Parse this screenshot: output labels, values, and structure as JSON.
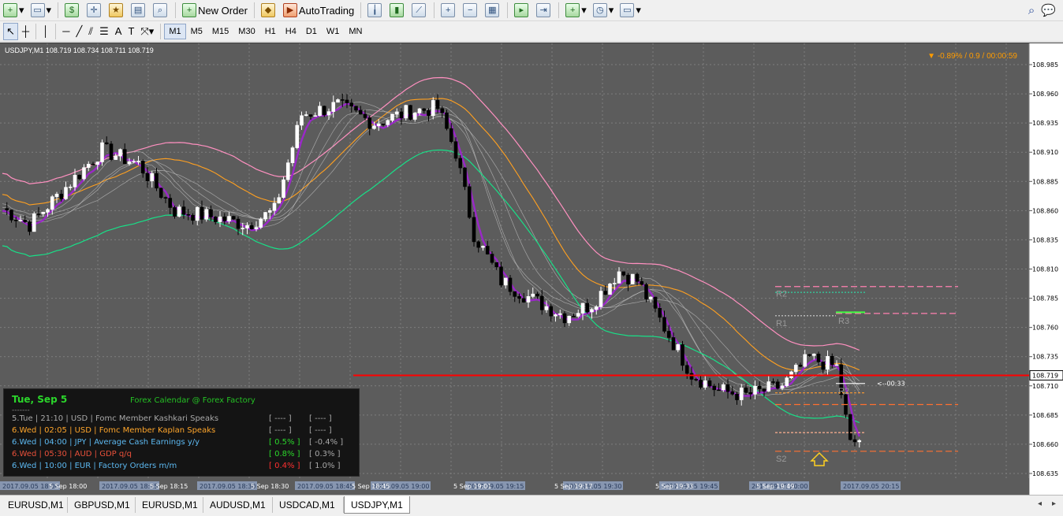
{
  "toolbar": {
    "new_order": "New Order",
    "auto_trading": "AutoTrading",
    "timeframes": [
      "M1",
      "M5",
      "M15",
      "M30",
      "H1",
      "H4",
      "D1",
      "W1",
      "MN"
    ],
    "active_timeframe": "M1"
  },
  "chart": {
    "title": "USDJPY,M1  108.719 108.734 108.711 108.719",
    "top_right": "▼ -0.89% / 0.9 / 00:00:59",
    "countdown": "<--00:33",
    "current_price": "108.719",
    "price_labels": [
      "108.985",
      "108.960",
      "108.935",
      "108.910",
      "108.885",
      "108.860",
      "108.835",
      "108.810",
      "108.785",
      "108.760",
      "108.735",
      "108.710",
      "108.685",
      "108.660",
      "108.635"
    ],
    "pivots": {
      "r2": "R2",
      "r1": "R1",
      "r3": "R3",
      "s2": "S2",
      "r2b": "R2"
    },
    "time_labels": [
      "5 Sep 18:00",
      "5 Sep 18:15",
      "5 Sep 18:30",
      "5 Sep 18:45",
      "5 Sep 19:01",
      "5 Sep 19:17",
      "5 Sep 19:33",
      "5 Sep 19:49",
      "5 Sep 20:05"
    ],
    "time_boxes": [
      "2017.09.05 18:00",
      "2017.09.05 18:15",
      "2017.09.05 18:30",
      "2017.09.05 18:45",
      "2017.09.05 19:00",
      "2017.09.05 19:15",
      "2017.09.05 19:30",
      "2017.09.05 19:45",
      "2017.09.05 20:00",
      "2017.09.05 20:15"
    ],
    "colors": {
      "background": "#5c5c5c",
      "bull": "#ffffff",
      "bear": "#000000",
      "purple": "#9a28c8",
      "green": "#18e088",
      "orange": "#ffa020",
      "pink": "#ff90c0",
      "red_line": "#ff0000"
    }
  },
  "calendar": {
    "day": "Tue, Sep 5",
    "source": "Forex Calendar @ Forex Factory",
    "dash": "-------",
    "rows": [
      {
        "text": "5.Tue  |  21:10  |  USD  |  Fomc Member Kashkari Speaks",
        "a": "[ ---- ]",
        "b": "[ ---- ]",
        "color": "#a8a8a8",
        "ac": "#a8a8a8",
        "bc": "#a8a8a8"
      },
      {
        "text": "6.Wed  |  02:05  |  USD  |  Fomc Member Kaplan Speaks",
        "a": "[ ---- ]",
        "b": "[ ---- ]",
        "color": "#ffa62b",
        "ac": "#a8a8a8",
        "bc": "#a8a8a8"
      },
      {
        "text": "6.Wed  |  04:00  |  JPY  |  Average Cash Earnings y/y",
        "a": "[ 0.5% ]",
        "b": "[ -0.4% ]",
        "color": "#5cb8f0",
        "ac": "#2bd62b",
        "bc": "#a8a8a8"
      },
      {
        "text": "6.Wed  |  05:30  |  AUD  |  GDP q/q",
        "a": "[ 0.8% ]",
        "b": "[ 0.3% ]",
        "color": "#e8503a",
        "ac": "#2bd62b",
        "bc": "#a8a8a8"
      },
      {
        "text": "6.Wed  |  10:00  |  EUR  |  Factory Orders m/m",
        "a": "[ 0.4% ]",
        "b": "[ 1.0% ]",
        "color": "#5cb8f0",
        "ac": "#ff3030",
        "bc": "#a8a8a8"
      }
    ]
  },
  "tabs": [
    "EURUSD,M1",
    "GBPUSD,M1",
    "EURUSD,M1",
    "AUDUSD,M1",
    "USDCAD,M1",
    "USDJPY,M1"
  ],
  "active_tab": "USDJPY,M1"
}
